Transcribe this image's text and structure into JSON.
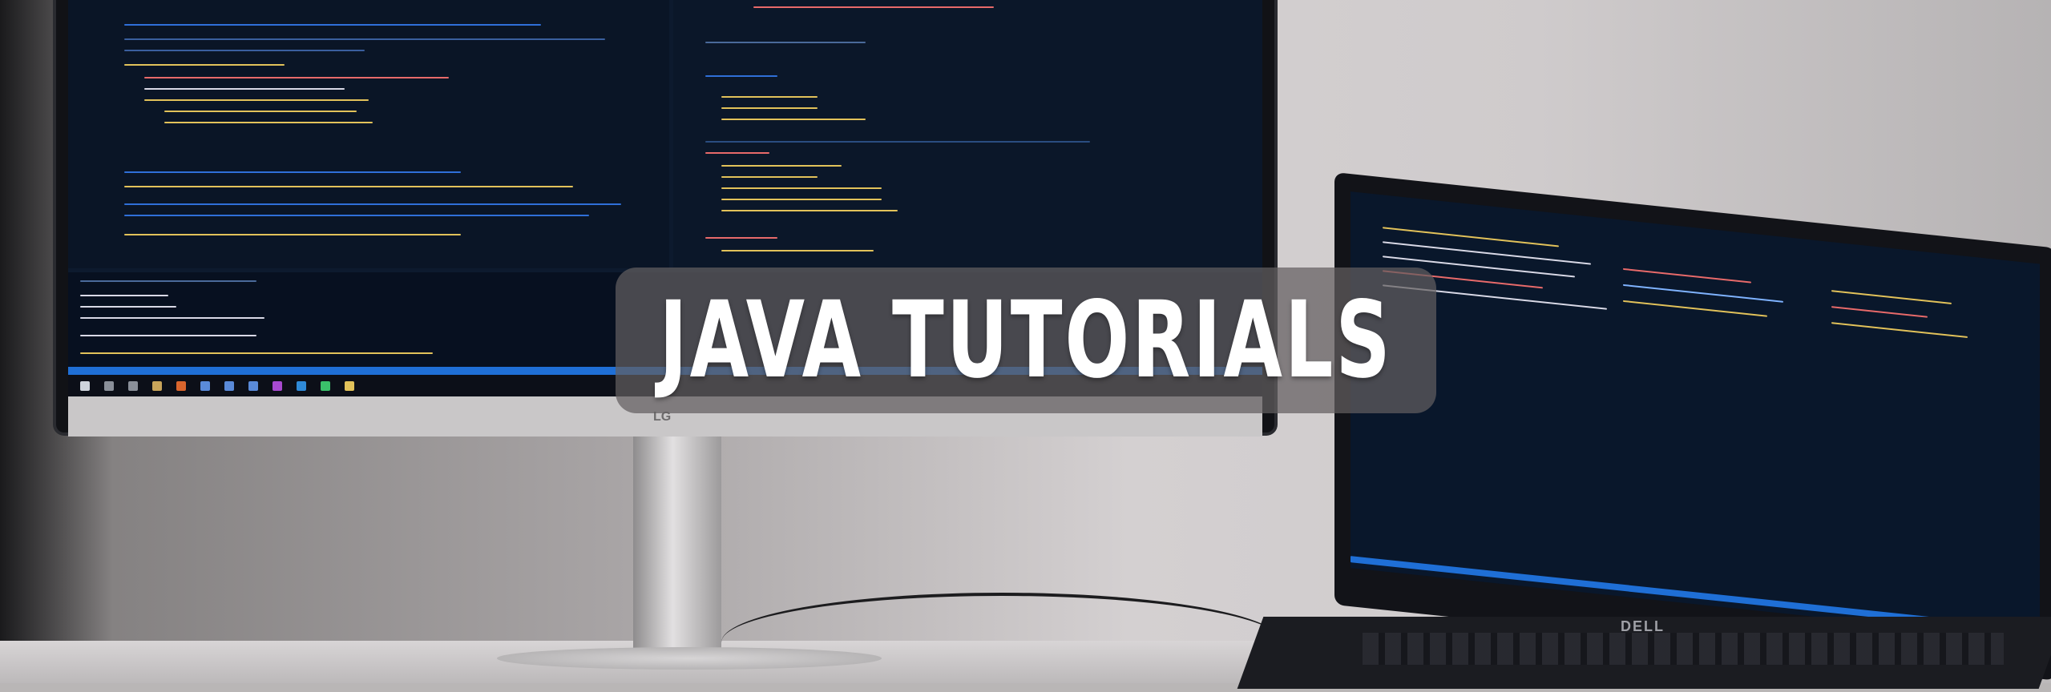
{
  "banner": {
    "title": "JAVA TUTORIALS"
  },
  "scene": {
    "monitor_brand": "LG",
    "laptop_brand": "DELL"
  },
  "colors": {
    "banner_bg": "#625e5f",
    "title_text": "#ffffff",
    "code_bg": "#0a1526",
    "status_bar": "#1f6fd6"
  }
}
